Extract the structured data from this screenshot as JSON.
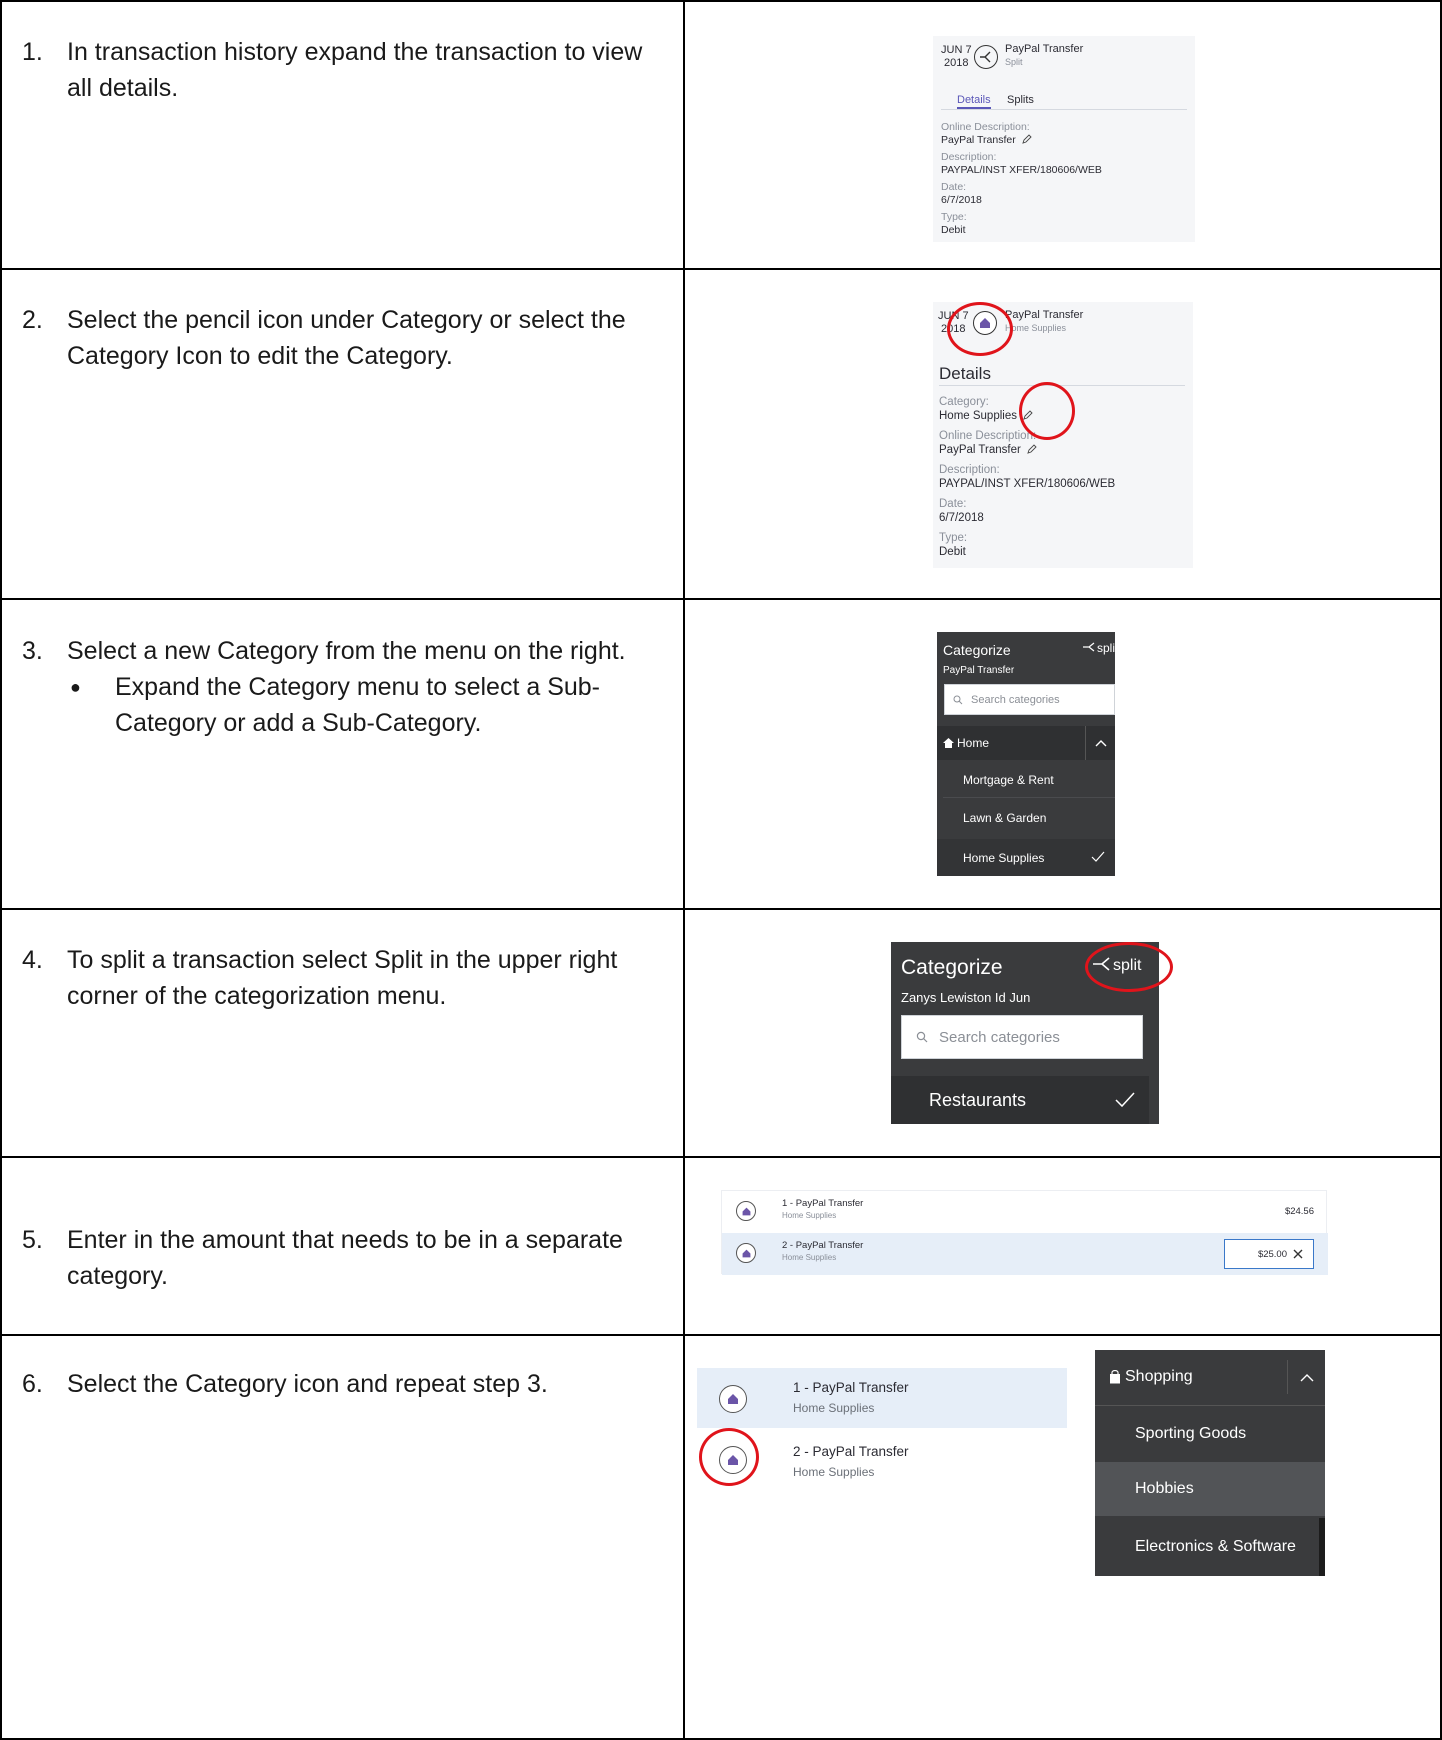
{
  "steps": [
    {
      "number": "1.",
      "text": "In transaction history expand the transaction to view all details.",
      "shot": {
        "month_day": "JUN 7",
        "year": "2018",
        "title": "PayPal Transfer",
        "subtitle": "Split",
        "tabs": [
          "Details",
          "Splits"
        ],
        "fields": [
          {
            "label": "Online Description:",
            "value": "PayPal Transfer"
          },
          {
            "label": "Description:",
            "value": "PAYPAL/INST XFER/180606/WEB"
          },
          {
            "label": "Date:",
            "value": "6/7/2018"
          },
          {
            "label": "Type:",
            "value": "Debit"
          }
        ]
      }
    },
    {
      "number": "2.",
      "text": "Select the pencil icon under Category or select the Category Icon to edit the Category.",
      "shot": {
        "month_day": "JUN 7",
        "year": "2018",
        "title": "PayPal Transfer",
        "subtitle": "Home Supplies",
        "heading": "Details",
        "fields": [
          {
            "label": "Category:",
            "value": "Home Supplies"
          },
          {
            "label": "Online Description:",
            "value": "PayPal Transfer"
          },
          {
            "label": "Description:",
            "value": "PAYPAL/INST XFER/180606/WEB"
          },
          {
            "label": "Date:",
            "value": "6/7/2018"
          },
          {
            "label": "Type:",
            "value": "Debit"
          }
        ]
      }
    },
    {
      "number": "3.",
      "text": "Select a new Category from the menu on the right.",
      "bullet": "Expand the Category menu to select a Sub-Category or add a Sub-Category.",
      "shot": {
        "title": "Categorize",
        "split": "split",
        "subtitle": "PayPal Transfer",
        "search_placeholder": "Search categories",
        "group": "Home",
        "items": [
          "Mortgage & Rent",
          "Lawn & Garden",
          "Home Supplies"
        ]
      }
    },
    {
      "number": "4.",
      "text": "To split a transaction select Split in the upper right corner of the categorization menu.",
      "shot": {
        "title": "Categorize",
        "split": "split",
        "subtitle": "Zanys Lewiston Id Jun",
        "search_placeholder": "Search categories",
        "selected": "Restaurants"
      }
    },
    {
      "number": "5.",
      "text": "Enter in the amount that needs to be in a separate category.",
      "shot": {
        "rows": [
          {
            "title": "1 - PayPal Transfer",
            "sub": "Home Supplies",
            "amount": "$24.56"
          },
          {
            "title": "2 - PayPal Transfer",
            "sub": "Home Supplies",
            "amount": "$25.00"
          }
        ]
      }
    },
    {
      "number": "6.",
      "text": "Select the Category icon and repeat step 3.",
      "shot": {
        "rows": [
          {
            "title": "1 - PayPal Transfer",
            "sub": "Home Supplies"
          },
          {
            "title": "2 - PayPal Transfer",
            "sub": "Home Supplies"
          }
        ],
        "group": "Shopping",
        "items": [
          "Sporting Goods",
          "Hobbies",
          "Electronics & Software"
        ]
      }
    }
  ],
  "colors": {
    "accent_purple": "#6b55a8",
    "red_ring": "#e0141b",
    "menu_dark": "#3a3b3d",
    "row_highlight": "#e6eef8"
  },
  "icons": [
    "split-icon",
    "home-icon",
    "pencil-icon",
    "search-icon",
    "chevron-up-icon",
    "checkmark-icon",
    "close-icon",
    "bag-icon"
  ]
}
